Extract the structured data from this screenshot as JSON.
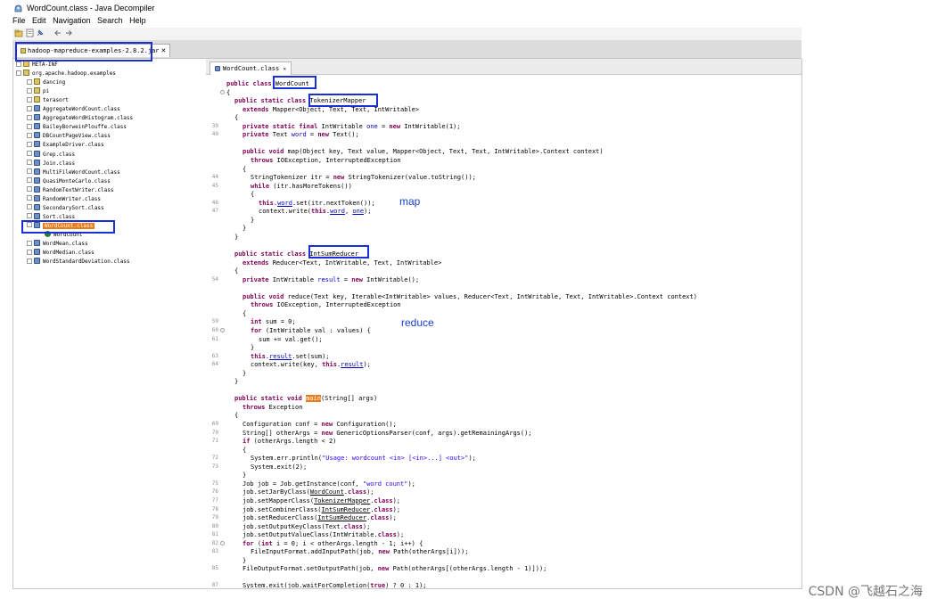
{
  "window": {
    "title": "WordCount.class - Java Decompiler"
  },
  "menu": [
    "File",
    "Edit",
    "Navigation",
    "Search",
    "Help"
  ],
  "toolbar": {
    "icons": [
      "open-file-icon",
      "open-folder-icon",
      "pin-icon",
      "back-arrow-icon",
      "forward-arrow-icon"
    ]
  },
  "jar_tab": {
    "label": "hadoop-mapreduce-examples-2.8.2.jar",
    "close": "✕"
  },
  "tree": [
    {
      "label": "META-INF",
      "icon": "folder",
      "indent": 0
    },
    {
      "label": "org.apache.hadoop.examples",
      "icon": "pkg",
      "indent": 0
    },
    {
      "label": "dancing",
      "icon": "pkg",
      "indent": 1
    },
    {
      "label": "pi",
      "icon": "pkg",
      "indent": 1
    },
    {
      "label": "terasort",
      "icon": "pkg",
      "indent": 1
    },
    {
      "label": "AggregateWordCount.class",
      "icon": "cls",
      "indent": 1
    },
    {
      "label": "AggregateWordHistogram.class",
      "icon": "cls",
      "indent": 1
    },
    {
      "label": "BaileyBorweinPlouffe.class",
      "icon": "cls",
      "indent": 1
    },
    {
      "label": "DBCountPageView.class",
      "icon": "cls",
      "indent": 1
    },
    {
      "label": "ExampleDriver.class",
      "icon": "cls",
      "indent": 1
    },
    {
      "label": "Grep.class",
      "icon": "cls",
      "indent": 1
    },
    {
      "label": "Join.class",
      "icon": "cls",
      "indent": 1
    },
    {
      "label": "MultiFileWordCount.class",
      "icon": "cls",
      "indent": 1
    },
    {
      "label": "QuasiMonteCarlo.class",
      "icon": "cls",
      "indent": 1
    },
    {
      "label": "RandomTextWriter.class",
      "icon": "cls",
      "indent": 1
    },
    {
      "label": "RandomWriter.class",
      "icon": "cls",
      "indent": 1
    },
    {
      "label": "SecondarySort.class",
      "icon": "cls",
      "indent": 1
    },
    {
      "label": "Sort.class",
      "icon": "cls",
      "indent": 1
    },
    {
      "label": "WordCount.class",
      "icon": "cls",
      "indent": 1,
      "selected": true
    },
    {
      "label": "WordCount",
      "icon": "circle",
      "indent": 2
    },
    {
      "label": "WordMean.class",
      "icon": "cls",
      "indent": 1
    },
    {
      "label": "WordMedian.class",
      "icon": "cls",
      "indent": 1
    },
    {
      "label": "WordStandardDeviation.class",
      "icon": "cls",
      "indent": 1
    }
  ],
  "editor_tab": {
    "label": "WordCount.class",
    "close": "✕"
  },
  "code": [
    {
      "n": "",
      "f": false,
      "i": 0,
      "p": [
        [
          "public class ",
          "kw"
        ],
        [
          "WordCount",
          ""
        ]
      ]
    },
    {
      "n": "",
      "f": true,
      "i": 0,
      "p": [
        [
          "{",
          ""
        ]
      ]
    },
    {
      "n": "",
      "f": false,
      "i": 1,
      "p": [
        [
          "public static class ",
          "kw"
        ],
        [
          "TokenizerMapper",
          ""
        ]
      ]
    },
    {
      "n": "",
      "f": false,
      "i": 2,
      "p": [
        [
          "extends ",
          "kw"
        ],
        [
          "Mapper<Object, Text, Text, IntWritable>",
          ""
        ]
      ]
    },
    {
      "n": "",
      "f": false,
      "i": 1,
      "p": [
        [
          "{",
          ""
        ]
      ]
    },
    {
      "n": "39",
      "f": false,
      "i": 2,
      "p": [
        [
          "private static final ",
          "kw"
        ],
        [
          "IntWritable ",
          ""
        ],
        [
          "one",
          "fd"
        ],
        [
          " = ",
          ""
        ],
        [
          "new ",
          "kw"
        ],
        [
          "IntWritable(1);",
          ""
        ]
      ]
    },
    {
      "n": "40",
      "f": false,
      "i": 2,
      "p": [
        [
          "private ",
          "kw"
        ],
        [
          "Text ",
          ""
        ],
        [
          "word",
          "fd"
        ],
        [
          " = ",
          ""
        ],
        [
          "new ",
          "kw"
        ],
        [
          "Text();",
          ""
        ]
      ]
    },
    {
      "n": "",
      "f": false,
      "i": 0,
      "p": []
    },
    {
      "n": "",
      "f": false,
      "i": 2,
      "p": [
        [
          "public void ",
          "kw"
        ],
        [
          "map(Object key, Text value, Mapper<Object, Text, Text, IntWritable>.Context context)",
          ""
        ]
      ]
    },
    {
      "n": "",
      "f": false,
      "i": 3,
      "p": [
        [
          "throws ",
          "kw"
        ],
        [
          "IOException, InterruptedException",
          ""
        ]
      ]
    },
    {
      "n": "",
      "f": false,
      "i": 2,
      "p": [
        [
          "{",
          ""
        ]
      ]
    },
    {
      "n": "44",
      "f": false,
      "i": 3,
      "p": [
        [
          "StringTokenizer itr = ",
          ""
        ],
        [
          "new ",
          "kw"
        ],
        [
          "StringTokenizer(value.toString());",
          ""
        ]
      ]
    },
    {
      "n": "45",
      "f": false,
      "i": 3,
      "p": [
        [
          "while ",
          "kw"
        ],
        [
          "(itr.hasMoreTokens())",
          ""
        ]
      ]
    },
    {
      "n": "",
      "f": false,
      "i": 3,
      "p": [
        [
          "{",
          ""
        ]
      ]
    },
    {
      "n": "46",
      "f": false,
      "i": 4,
      "p": [
        [
          "this",
          "kw"
        ],
        [
          ".",
          ""
        ],
        [
          "word",
          "fd ul"
        ],
        [
          ".set(itr.nextToken());",
          ""
        ]
      ]
    },
    {
      "n": "47",
      "f": false,
      "i": 4,
      "p": [
        [
          "context.write(",
          ""
        ],
        [
          "this",
          "kw"
        ],
        [
          ".",
          ""
        ],
        [
          "word",
          "fd ul"
        ],
        [
          ", ",
          ""
        ],
        [
          "one",
          "fd ul"
        ],
        [
          ");",
          ""
        ]
      ]
    },
    {
      "n": "",
      "f": false,
      "i": 3,
      "p": [
        [
          "}",
          ""
        ]
      ]
    },
    {
      "n": "",
      "f": false,
      "i": 2,
      "p": [
        [
          "}",
          ""
        ]
      ]
    },
    {
      "n": "",
      "f": false,
      "i": 1,
      "p": [
        [
          "}",
          ""
        ]
      ]
    },
    {
      "n": "",
      "f": false,
      "i": 0,
      "p": []
    },
    {
      "n": "",
      "f": false,
      "i": 1,
      "p": [
        [
          "public static class ",
          "kw"
        ],
        [
          "IntSumReducer",
          ""
        ]
      ]
    },
    {
      "n": "",
      "f": false,
      "i": 2,
      "p": [
        [
          "extends ",
          "kw"
        ],
        [
          "Reducer<Text, IntWritable, Text, IntWritable>",
          ""
        ]
      ]
    },
    {
      "n": "",
      "f": false,
      "i": 1,
      "p": [
        [
          "{",
          ""
        ]
      ]
    },
    {
      "n": "54",
      "f": false,
      "i": 2,
      "p": [
        [
          "private ",
          "kw"
        ],
        [
          "IntWritable ",
          ""
        ],
        [
          "result",
          "fd"
        ],
        [
          " = ",
          ""
        ],
        [
          "new ",
          "kw"
        ],
        [
          "IntWritable();",
          ""
        ]
      ]
    },
    {
      "n": "",
      "f": false,
      "i": 0,
      "p": []
    },
    {
      "n": "",
      "f": false,
      "i": 2,
      "p": [
        [
          "public void ",
          "kw"
        ],
        [
          "reduce(Text key, Iterable<IntWritable> values, Reducer<Text, IntWritable, Text, IntWritable>.Context context)",
          ""
        ]
      ]
    },
    {
      "n": "",
      "f": false,
      "i": 3,
      "p": [
        [
          "throws ",
          "kw"
        ],
        [
          "IOException, InterruptedException",
          ""
        ]
      ]
    },
    {
      "n": "",
      "f": false,
      "i": 2,
      "p": [
        [
          "{",
          ""
        ]
      ]
    },
    {
      "n": "59",
      "f": false,
      "i": 3,
      "p": [
        [
          "int ",
          "kw"
        ],
        [
          "sum = 0;",
          ""
        ]
      ]
    },
    {
      "n": "60",
      "f": true,
      "i": 3,
      "p": [
        [
          "for ",
          "kw"
        ],
        [
          "(IntWritable val : values) {",
          ""
        ]
      ]
    },
    {
      "n": "61",
      "f": false,
      "i": 4,
      "p": [
        [
          "sum += val.get();",
          ""
        ]
      ]
    },
    {
      "n": "",
      "f": false,
      "i": 3,
      "p": [
        [
          "}",
          ""
        ]
      ]
    },
    {
      "n": "63",
      "f": false,
      "i": 3,
      "p": [
        [
          "this",
          "kw"
        ],
        [
          ".",
          ""
        ],
        [
          "result",
          "fd ul"
        ],
        [
          ".set(sum);",
          ""
        ]
      ]
    },
    {
      "n": "64",
      "f": false,
      "i": 3,
      "p": [
        [
          "context.write(key, ",
          ""
        ],
        [
          "this",
          "kw"
        ],
        [
          ".",
          ""
        ],
        [
          "result",
          "fd ul"
        ],
        [
          ");",
          ""
        ]
      ]
    },
    {
      "n": "",
      "f": false,
      "i": 2,
      "p": [
        [
          "}",
          ""
        ]
      ]
    },
    {
      "n": "",
      "f": false,
      "i": 1,
      "p": [
        [
          "}",
          ""
        ]
      ]
    },
    {
      "n": "",
      "f": false,
      "i": 0,
      "p": []
    },
    {
      "n": "",
      "f": false,
      "i": 1,
      "p": [
        [
          "public static void ",
          "kw"
        ],
        [
          "main",
          "hl"
        ],
        [
          "(String[] args)",
          ""
        ]
      ]
    },
    {
      "n": "",
      "f": false,
      "i": 2,
      "p": [
        [
          "throws ",
          "kw"
        ],
        [
          "Exception",
          ""
        ]
      ]
    },
    {
      "n": "",
      "f": false,
      "i": 1,
      "p": [
        [
          "{",
          ""
        ]
      ]
    },
    {
      "n": "69",
      "f": false,
      "i": 2,
      "p": [
        [
          "Configuration conf = ",
          ""
        ],
        [
          "new ",
          "kw"
        ],
        [
          "Configuration();",
          ""
        ]
      ]
    },
    {
      "n": "70",
      "f": false,
      "i": 2,
      "p": [
        [
          "String[] otherArgs = ",
          ""
        ],
        [
          "new ",
          "kw"
        ],
        [
          "GenericOptionsParser(conf, args).getRemainingArgs();",
          ""
        ]
      ]
    },
    {
      "n": "71",
      "f": false,
      "i": 2,
      "p": [
        [
          "if ",
          "kw"
        ],
        [
          "(otherArgs.length < 2)",
          ""
        ]
      ]
    },
    {
      "n": "",
      "f": false,
      "i": 2,
      "p": [
        [
          "{",
          ""
        ]
      ]
    },
    {
      "n": "72",
      "f": false,
      "i": 3,
      "p": [
        [
          "System.err.println(",
          ""
        ],
        [
          "\"Usage: wordcount <in> [<in>...] <out>\"",
          "st"
        ],
        [
          ");",
          ""
        ]
      ]
    },
    {
      "n": "73",
      "f": false,
      "i": 3,
      "p": [
        [
          "System.exit(2);",
          ""
        ]
      ]
    },
    {
      "n": "",
      "f": false,
      "i": 2,
      "p": [
        [
          "}",
          ""
        ]
      ]
    },
    {
      "n": "75",
      "f": false,
      "i": 2,
      "p": [
        [
          "Job job = Job.getInstance(conf, ",
          ""
        ],
        [
          "\"word count\"",
          "st"
        ],
        [
          ");",
          ""
        ]
      ]
    },
    {
      "n": "76",
      "f": false,
      "i": 2,
      "p": [
        [
          "job.setJarByClass(",
          ""
        ],
        [
          "WordCount",
          "ul"
        ],
        [
          ".",
          ""
        ],
        [
          "class",
          "kw"
        ],
        [
          ");",
          ""
        ]
      ]
    },
    {
      "n": "77",
      "f": false,
      "i": 2,
      "p": [
        [
          "job.setMapperClass(",
          ""
        ],
        [
          "TokenizerMapper",
          "ul"
        ],
        [
          ".",
          ""
        ],
        [
          "class",
          "kw"
        ],
        [
          ");",
          ""
        ]
      ]
    },
    {
      "n": "78",
      "f": false,
      "i": 2,
      "p": [
        [
          "job.setCombinerClass(",
          ""
        ],
        [
          "IntSumReducer",
          "ul"
        ],
        [
          ".",
          ""
        ],
        [
          "class",
          "kw"
        ],
        [
          ");",
          ""
        ]
      ]
    },
    {
      "n": "79",
      "f": false,
      "i": 2,
      "p": [
        [
          "job.setReducerClass(",
          ""
        ],
        [
          "IntSumReducer",
          "ul"
        ],
        [
          ".",
          ""
        ],
        [
          "class",
          "kw"
        ],
        [
          ");",
          ""
        ]
      ]
    },
    {
      "n": "80",
      "f": false,
      "i": 2,
      "p": [
        [
          "job.setOutputKeyClass(Text.",
          ""
        ],
        [
          "class",
          "kw"
        ],
        [
          ");",
          ""
        ]
      ]
    },
    {
      "n": "81",
      "f": false,
      "i": 2,
      "p": [
        [
          "job.setOutputValueClass(IntWritable.",
          ""
        ],
        [
          "class",
          "kw"
        ],
        [
          ");",
          ""
        ]
      ]
    },
    {
      "n": "82",
      "f": true,
      "i": 2,
      "p": [
        [
          "for ",
          "kw"
        ],
        [
          "(",
          ""
        ],
        [
          "int ",
          "kw"
        ],
        [
          "i = 0; i < otherArgs.length - 1; i++) {",
          ""
        ]
      ]
    },
    {
      "n": "83",
      "f": false,
      "i": 3,
      "p": [
        [
          "FileInputFormat.addInputPath(job, ",
          ""
        ],
        [
          "new ",
          "kw"
        ],
        [
          "Path(otherArgs[i]));",
          ""
        ]
      ]
    },
    {
      "n": "",
      "f": false,
      "i": 2,
      "p": [
        [
          "}",
          ""
        ]
      ]
    },
    {
      "n": "85",
      "f": false,
      "i": 2,
      "p": [
        [
          "FileOutputFormat.setOutputPath(job, ",
          ""
        ],
        [
          "new ",
          "kw"
        ],
        [
          "Path(otherArgs[(otherArgs.length - 1)]));",
          ""
        ]
      ]
    },
    {
      "n": "",
      "f": false,
      "i": 0,
      "p": []
    },
    {
      "n": "87",
      "f": false,
      "i": 2,
      "p": [
        [
          "System.exit(job.waitForCompletion(",
          ""
        ],
        [
          "true",
          "kw"
        ],
        [
          ") ? 0 : 1);",
          ""
        ]
      ]
    }
  ],
  "annotations": {
    "map": "map",
    "reduce": "reduce"
  },
  "watermark": "CSDN @飞越石之海"
}
